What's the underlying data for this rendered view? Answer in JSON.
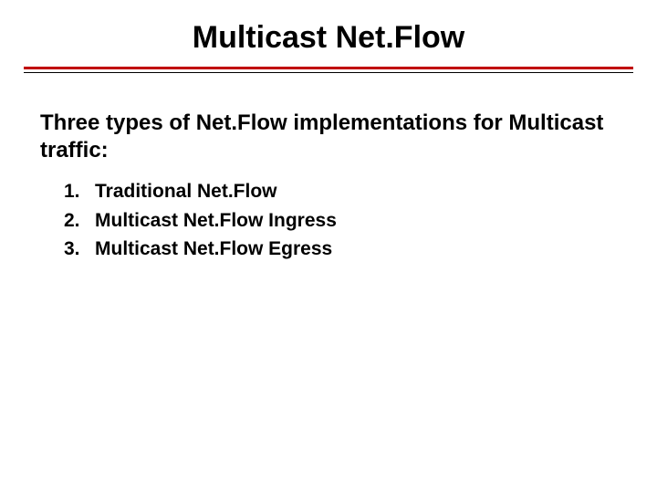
{
  "title": "Multicast Net.Flow",
  "intro": "Three types of Net.Flow implementations for Multicast traffic:",
  "items": [
    {
      "num": "1.",
      "text": "Traditional Net.Flow"
    },
    {
      "num": "2.",
      "text": "Multicast Net.Flow Ingress"
    },
    {
      "num": "3.",
      "text": "Multicast Net.Flow Egress"
    }
  ]
}
